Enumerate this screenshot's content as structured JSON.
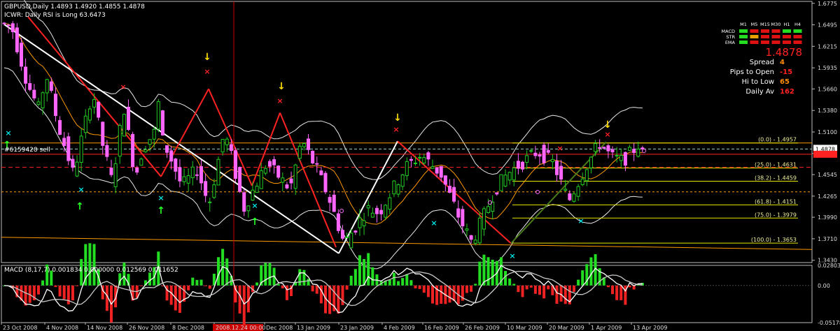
{
  "header": {
    "line1": "GBPUSD,Daily  1.4893 1.4920 1.4855 1.4878",
    "line2": "ICWR: Daily RSI is Long 63.6473"
  },
  "order_label": "#6159428 sell",
  "price_tag": "1.4878",
  "panel": {
    "timeframes": [
      "M1",
      "M5",
      "M15",
      "M30",
      "H1",
      "H4"
    ],
    "rows": [
      {
        "name": "MACD",
        "colors": [
          "#22dd22",
          "#dd1111",
          "#dd1111",
          "#dd1111",
          "#22dd22",
          "#22dd22"
        ]
      },
      {
        "name": "STR",
        "colors": [
          "#22dd22",
          "#e8a000",
          "#dd1111",
          "#dd1111",
          "#dd1111",
          "#dd1111"
        ]
      },
      {
        "name": "EMA",
        "colors": [
          "#22dd22",
          "#dd1111",
          "#dd1111",
          "#dd1111",
          "#dd1111",
          "#dd1111"
        ]
      }
    ],
    "price": "1.4878",
    "stats": [
      {
        "label": "Spread",
        "value": "4",
        "color": "#ff8c00"
      },
      {
        "label": "Pips to Open",
        "value": "-15",
        "color": "#ff2222"
      },
      {
        "label": "Hi to Low",
        "value": "65",
        "color": "#ff8c00"
      },
      {
        "label": "Daily Av",
        "value": "162",
        "color": "#ff2222"
      }
    ]
  },
  "macd_label": "MACD  (8,17,7) 0.001834 0.000000 0.012569 0.011652",
  "date_highlight": "2008.12.24 00:00",
  "colors": {
    "bull": "#22cc22",
    "bear": "#ff66ff",
    "up_arrow": "#22ff22",
    "down_arrow": "#ffdd00",
    "x_mark": "#ff2222",
    "cross": "#00e5e5"
  },
  "chart_data": {
    "type": "candlestick",
    "symbol": "GBPUSD",
    "timeframe": "Daily",
    "ylim": [
      1.34,
      1.68
    ],
    "y_ticks": [
      "1.6775",
      "1.6495",
      "1.6215",
      "1.5935",
      "1.5660",
      "1.5380",
      "1.5100",
      "1.4820",
      "1.4545",
      "1.4265",
      "1.3990",
      "1.3710",
      "1.3430"
    ],
    "x_labels": [
      "23 Oct 2008",
      "4 Nov 2008",
      "14 Nov 2008",
      "26 Nov 2008",
      "8 Dec 2008",
      "2008.12.24 00:00",
      "Dec 2008",
      "13 Jan 2009",
      "23 Jan 2009",
      "4 Feb 2009",
      "16 Feb 2009",
      "26 Feb 2009",
      "10 Mar 2009",
      "20 Mar 2009",
      "1 Apr 2009",
      "13 Apr 2009"
    ],
    "fib_levels": [
      {
        "label": "(0.0) - 1.4957",
        "value": 1.4957
      },
      {
        "label": "(25.0) - 1.4631",
        "value": 1.4631
      },
      {
        "label": "(38.2) - 1.4459",
        "value": 1.4459
      },
      {
        "label": "(61.8) - 1.4151",
        "value": 1.4151
      },
      {
        "label": "(75.0) - 1.3979",
        "value": 1.3979
      },
      {
        "label": "(100.0) - 1.3653",
        "value": 1.3653
      }
    ],
    "last_close": 1.4878,
    "macd": {
      "ylim": [
        -0.05178,
        0.028033
      ],
      "y_ticks": [
        "0.028033",
        "0.00",
        "-0.05178"
      ]
    }
  }
}
